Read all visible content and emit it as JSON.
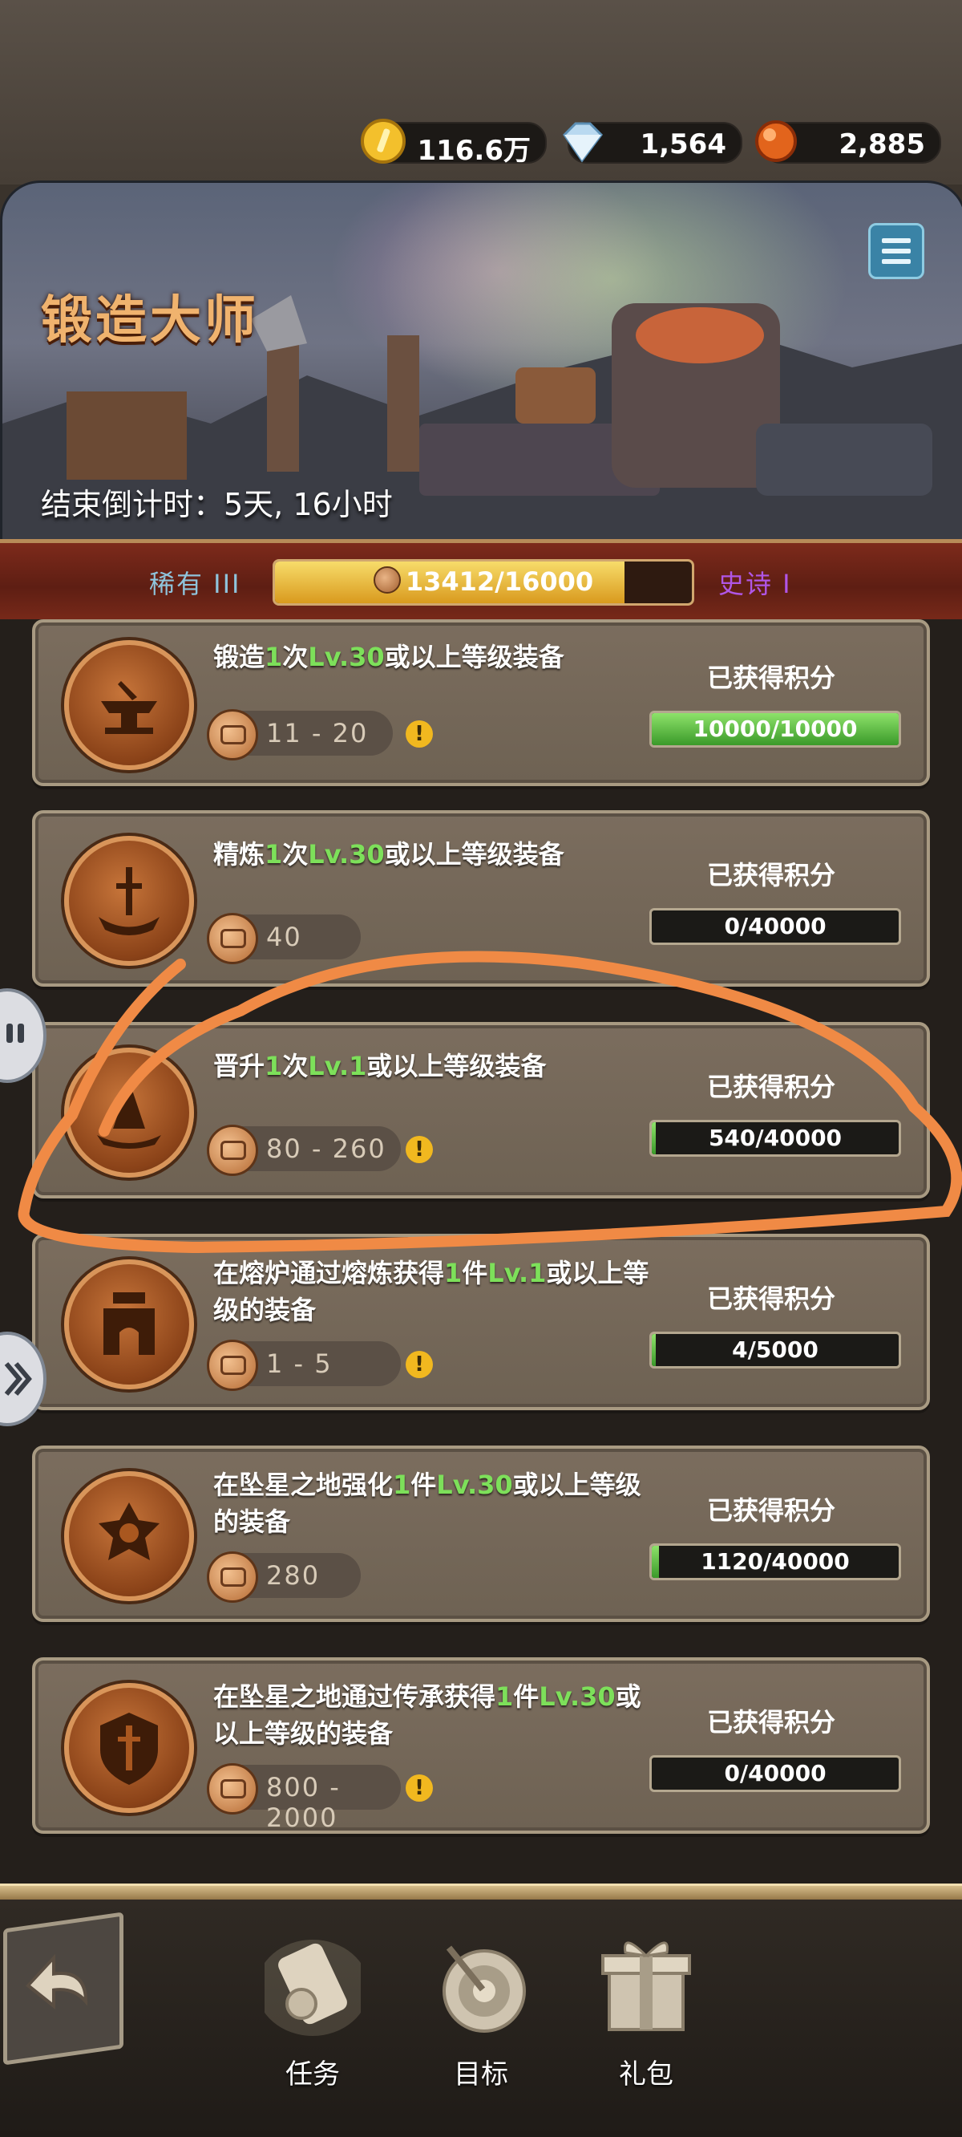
{
  "currency": [
    {
      "name": "gold",
      "value": "116.6万",
      "icon": "gold-coin-icon",
      "color": "#f3c02c"
    },
    {
      "name": "diamond",
      "value": "1,564",
      "icon": "diamond-icon",
      "color": "#b9d9f0"
    },
    {
      "name": "ember",
      "value": "2,885",
      "icon": "ember-orb-icon",
      "color": "#e2641c"
    }
  ],
  "banner": {
    "title": "锻造大师",
    "countdown": "结束倒计时：5天, 16小时"
  },
  "progress": {
    "current_tier": "稀有 III",
    "next_tier": "史诗 I",
    "label": "13412/16000",
    "current": 13412,
    "max": 16000
  },
  "tasks": [
    {
      "parts": [
        "锻造",
        "1",
        "次",
        "Lv.30",
        "或以上等级装备"
      ],
      "reward": "11 - 20",
      "warn": true,
      "score_label": "已获得积分",
      "score": "10000/10000",
      "fraction": 1.0
    },
    {
      "parts": [
        "精炼",
        "1",
        "次",
        "Lv.30",
        "或以上等级装备"
      ],
      "reward": "40",
      "warn": false,
      "score_label": "已获得积分",
      "score": "0/40000",
      "fraction": 0.0
    },
    {
      "parts": [
        "晋升",
        "1",
        "次",
        "Lv.1",
        "或以上等级装备"
      ],
      "reward": "80 - 260",
      "warn": true,
      "score_label": "已获得积分",
      "score": "540/40000",
      "fraction": 0.0135
    },
    {
      "parts": [
        "在熔炉通过熔炼获得",
        "1",
        "件",
        "Lv.1",
        "或以上等级的装备"
      ],
      "reward": "1 - 5",
      "warn": true,
      "score_label": "已获得积分",
      "score": "4/5000",
      "fraction": 0.0008
    },
    {
      "parts": [
        "在坠星之地强化",
        "1",
        "件",
        "Lv.30",
        "或以上等级的装备"
      ],
      "reward": "280",
      "warn": false,
      "score_label": "已获得积分",
      "score": "1120/40000",
      "fraction": 0.028
    },
    {
      "parts": [
        "在坠星之地通过传承获得",
        "1",
        "件",
        "Lv.30",
        "或以上等级的装备"
      ],
      "reward": "800 - 2000",
      "warn": true,
      "score_label": "已获得积分",
      "score": "0/40000",
      "fraction": 0.0
    }
  ],
  "footer": {
    "tabs": [
      {
        "label": "任务",
        "icon": "scroll-icon"
      },
      {
        "label": "目标",
        "icon": "target-icon"
      },
      {
        "label": "礼包",
        "icon": "gift-box-icon"
      }
    ],
    "back_icon": "back-arrow-icon"
  }
}
